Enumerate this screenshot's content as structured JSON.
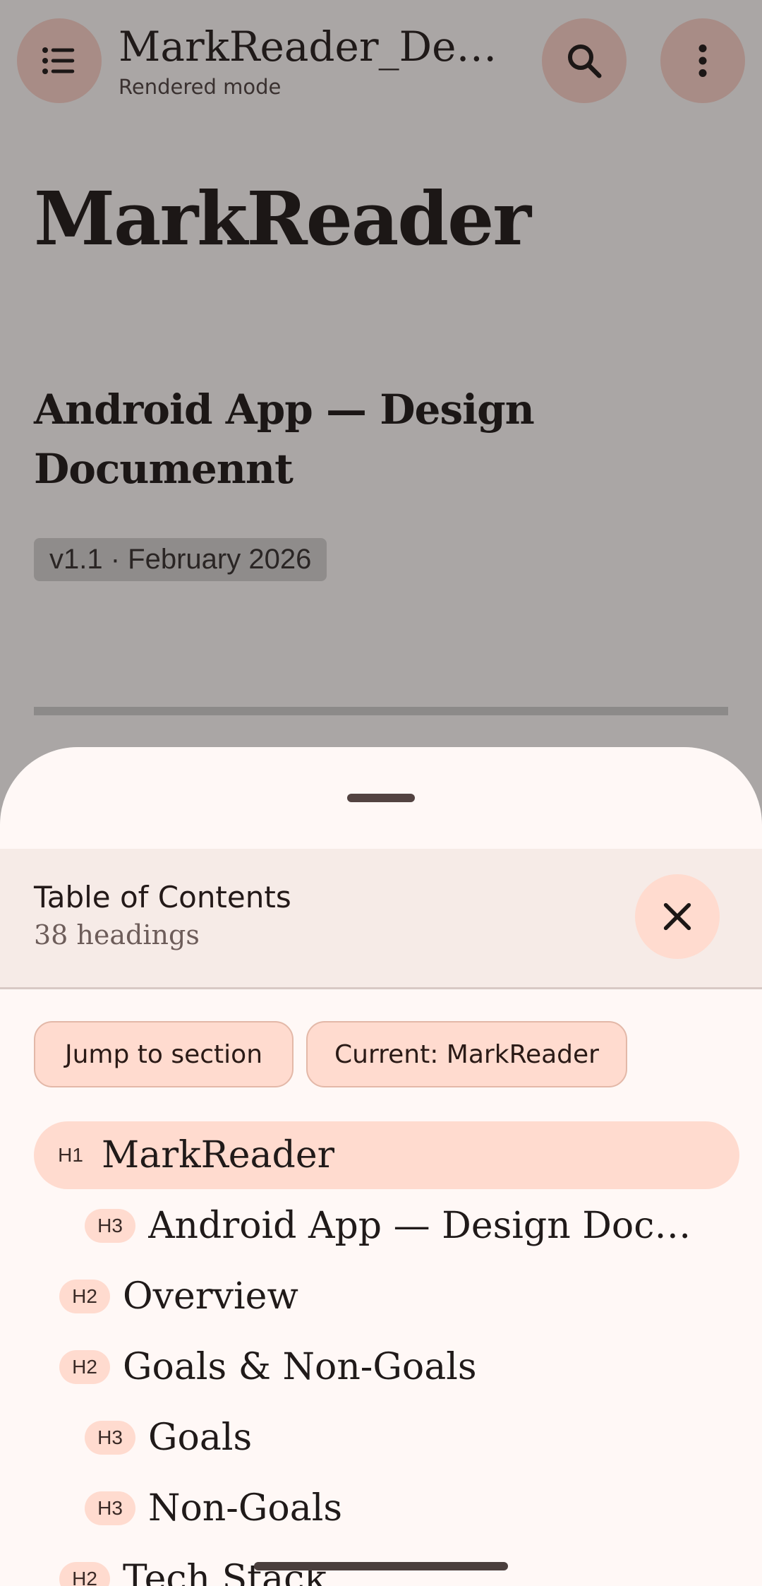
{
  "topbar": {
    "title": "MarkReader_Desi…",
    "subtitle": "Rendered mode",
    "icons": {
      "menu": "list-icon",
      "search": "search-icon",
      "more": "more-vert-icon"
    }
  },
  "document": {
    "heading1": "MarkReader",
    "heading3": "Android App — Design Documennt",
    "version": "v1.1 · February 2026"
  },
  "toc_sheet": {
    "title": "Table of Contents",
    "count": "38 headings",
    "chips": {
      "jump": "Jump to section",
      "current": "Current: MarkReader"
    },
    "items": [
      {
        "level": "H1",
        "label": "MarkReader",
        "active": true
      },
      {
        "level": "H3",
        "label": "Android App — Design Docume…"
      },
      {
        "level": "H2",
        "label": "Overview"
      },
      {
        "level": "H2",
        "label": "Goals & Non-Goals"
      },
      {
        "level": "H3",
        "label": "Goals"
      },
      {
        "level": "H3",
        "label": "Non-Goals"
      },
      {
        "level": "H2",
        "label": "Tech Stack"
      }
    ]
  },
  "colors": {
    "scrim": "#aaa6a5",
    "accent_container": "#ffdbcf",
    "sheet_surface": "#fff8f6"
  }
}
